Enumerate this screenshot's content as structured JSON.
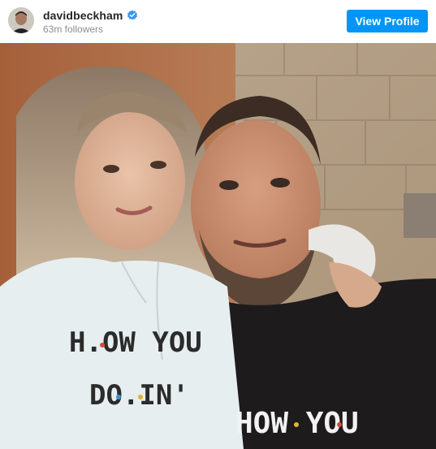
{
  "profile": {
    "username": "davidbeckham",
    "followers": "63m followers",
    "verified": true,
    "view_profile_label": "View Profile",
    "avatar_icon": "avatar-portrait-icon",
    "verified_icon": "verified-badge-icon"
  },
  "post": {
    "left_hoodie_text_line1": "H.OW YOU",
    "left_hoodie_text_line2": "DO.IN'",
    "right_hoodie_text": "HOW YOU"
  },
  "colors": {
    "button": "#0095f6",
    "verified": "#3897f0",
    "username": "#262626",
    "muted": "#8e8e8e"
  }
}
